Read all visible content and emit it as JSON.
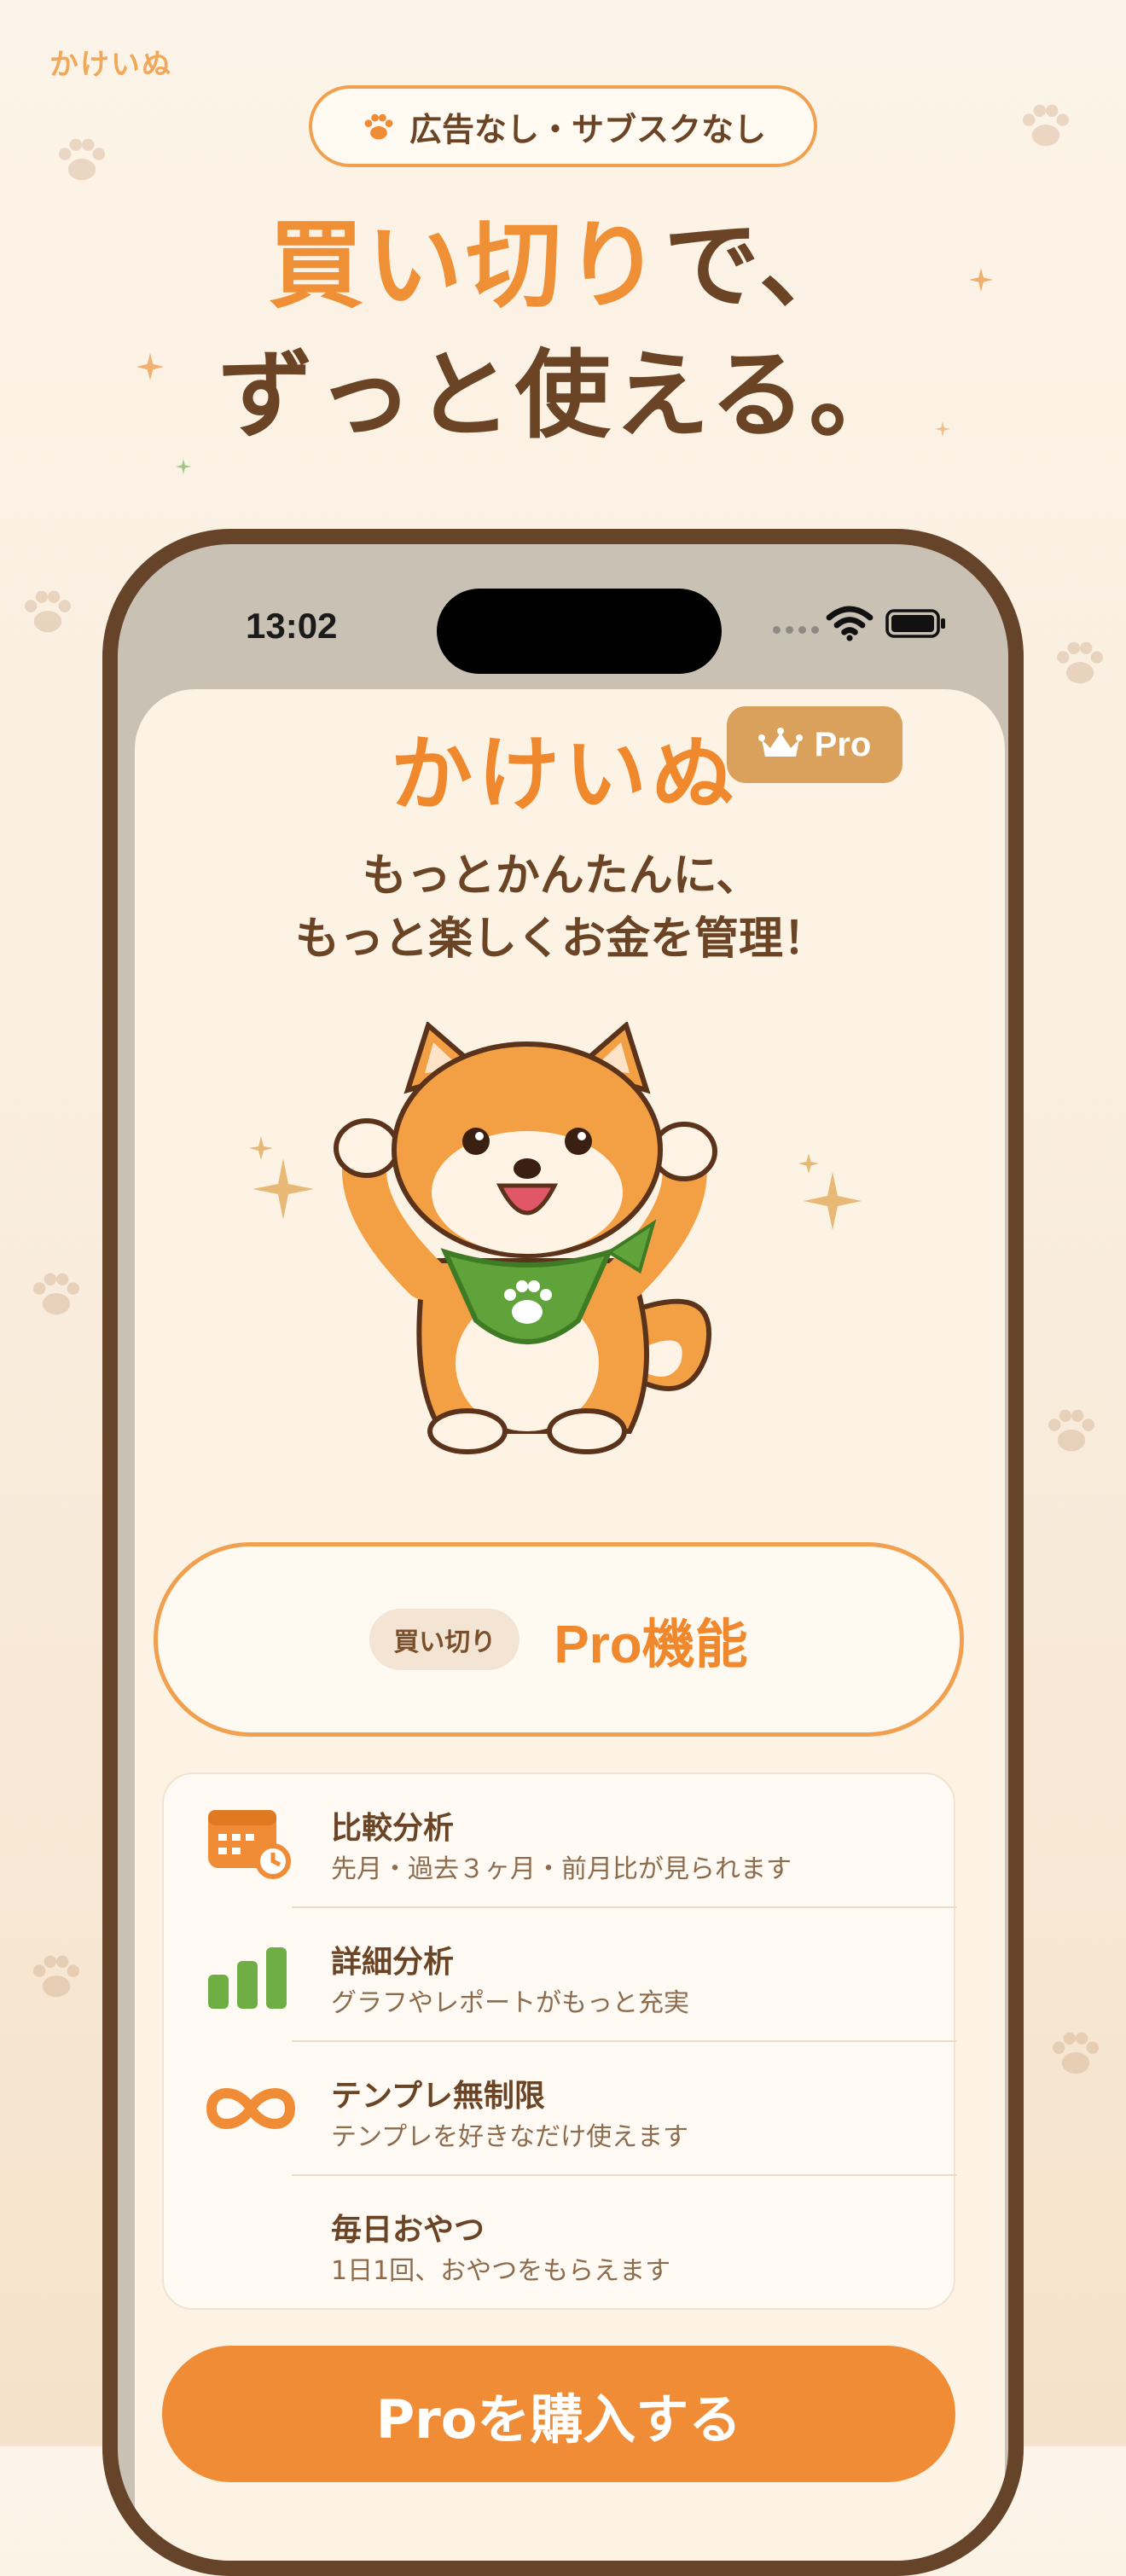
{
  "brand_small": "かけいぬ",
  "header_pill": {
    "label": "広告なし・サブスクなし",
    "icon": "paw-icon"
  },
  "headline": {
    "accent": "買い切り",
    "rest_line1": "で、",
    "line2": "ずっと使える。"
  },
  "status_bar": {
    "time": "13:02"
  },
  "app": {
    "logo": "かけいぬ",
    "pro_badge": "Pro",
    "tagline_line1": "もっとかんたんに、",
    "tagline_line2": "もっと楽しくお金を管理！"
  },
  "promo": {
    "chip": "買い切り",
    "title": "Pro機能"
  },
  "features": [
    {
      "icon": "calendar-icon",
      "title": "比較分析",
      "desc": "先月・過去３ヶ月・前月比が見られます"
    },
    {
      "icon": "bar-chart-icon",
      "title": "詳細分析",
      "desc": "グラフやレポートがもっと充実"
    },
    {
      "icon": "infinity-icon",
      "title": "テンプレ無制限",
      "desc": "テンプレを好きなだけ使えます"
    },
    {
      "icon": "",
      "title": "毎日おやつ",
      "desc": "1日1回、おやつをもらえます"
    }
  ],
  "cta": {
    "label": "Proを購入する"
  },
  "colors": {
    "accent": "#f0892e",
    "brown": "#6b4426",
    "green": "#6fae44"
  }
}
